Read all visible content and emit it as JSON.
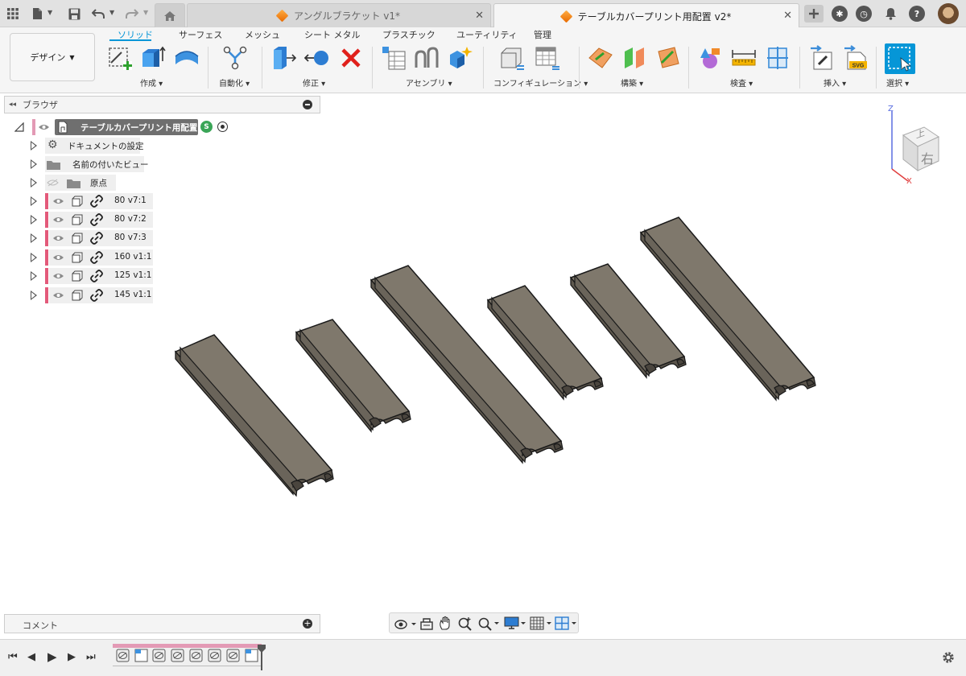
{
  "titlebar": {
    "tabs": [
      {
        "label": "アングルブラケット v1*",
        "active": false
      },
      {
        "label": "テーブルカバープリント用配置 v2*",
        "active": true
      }
    ]
  },
  "ribbon": {
    "workspace": "デザイン",
    "tabs": [
      "ソリッド",
      "サーフェス",
      "メッシュ",
      "シート メタル",
      "プラスチック",
      "ユーティリティ",
      "管理"
    ],
    "active_tab": "ソリッド",
    "groups": [
      "作成",
      "自動化",
      "修正",
      "アセンブリ",
      "コンフィギュレーション",
      "構築",
      "検査",
      "挿入",
      "選択"
    ]
  },
  "browser": {
    "title": "ブラウザ",
    "root": "テーブルカバープリント用配置 v2",
    "nodes": [
      {
        "label": "ドキュメントの設定",
        "kind": "settings"
      },
      {
        "label": "名前の付いたビュー",
        "kind": "folder"
      },
      {
        "label": "原点",
        "kind": "origin"
      },
      {
        "label": "80 v7:1",
        "kind": "component"
      },
      {
        "label": "80 v7:2",
        "kind": "component"
      },
      {
        "label": "80 v7:3",
        "kind": "component"
      },
      {
        "label": "160 v1:1",
        "kind": "component"
      },
      {
        "label": "125 v1:1",
        "kind": "component"
      },
      {
        "label": "145 v1:1",
        "kind": "component"
      }
    ]
  },
  "viewcube": {
    "face_label": "右",
    "top_label": "上",
    "axis_z": "Z",
    "axis_x": "X"
  },
  "comments": {
    "title": "コメント"
  },
  "colors": {
    "accent": "#0696d7",
    "part_face": "#7f786c",
    "part_side": "#5e584e",
    "marker": "#e35a7a"
  }
}
